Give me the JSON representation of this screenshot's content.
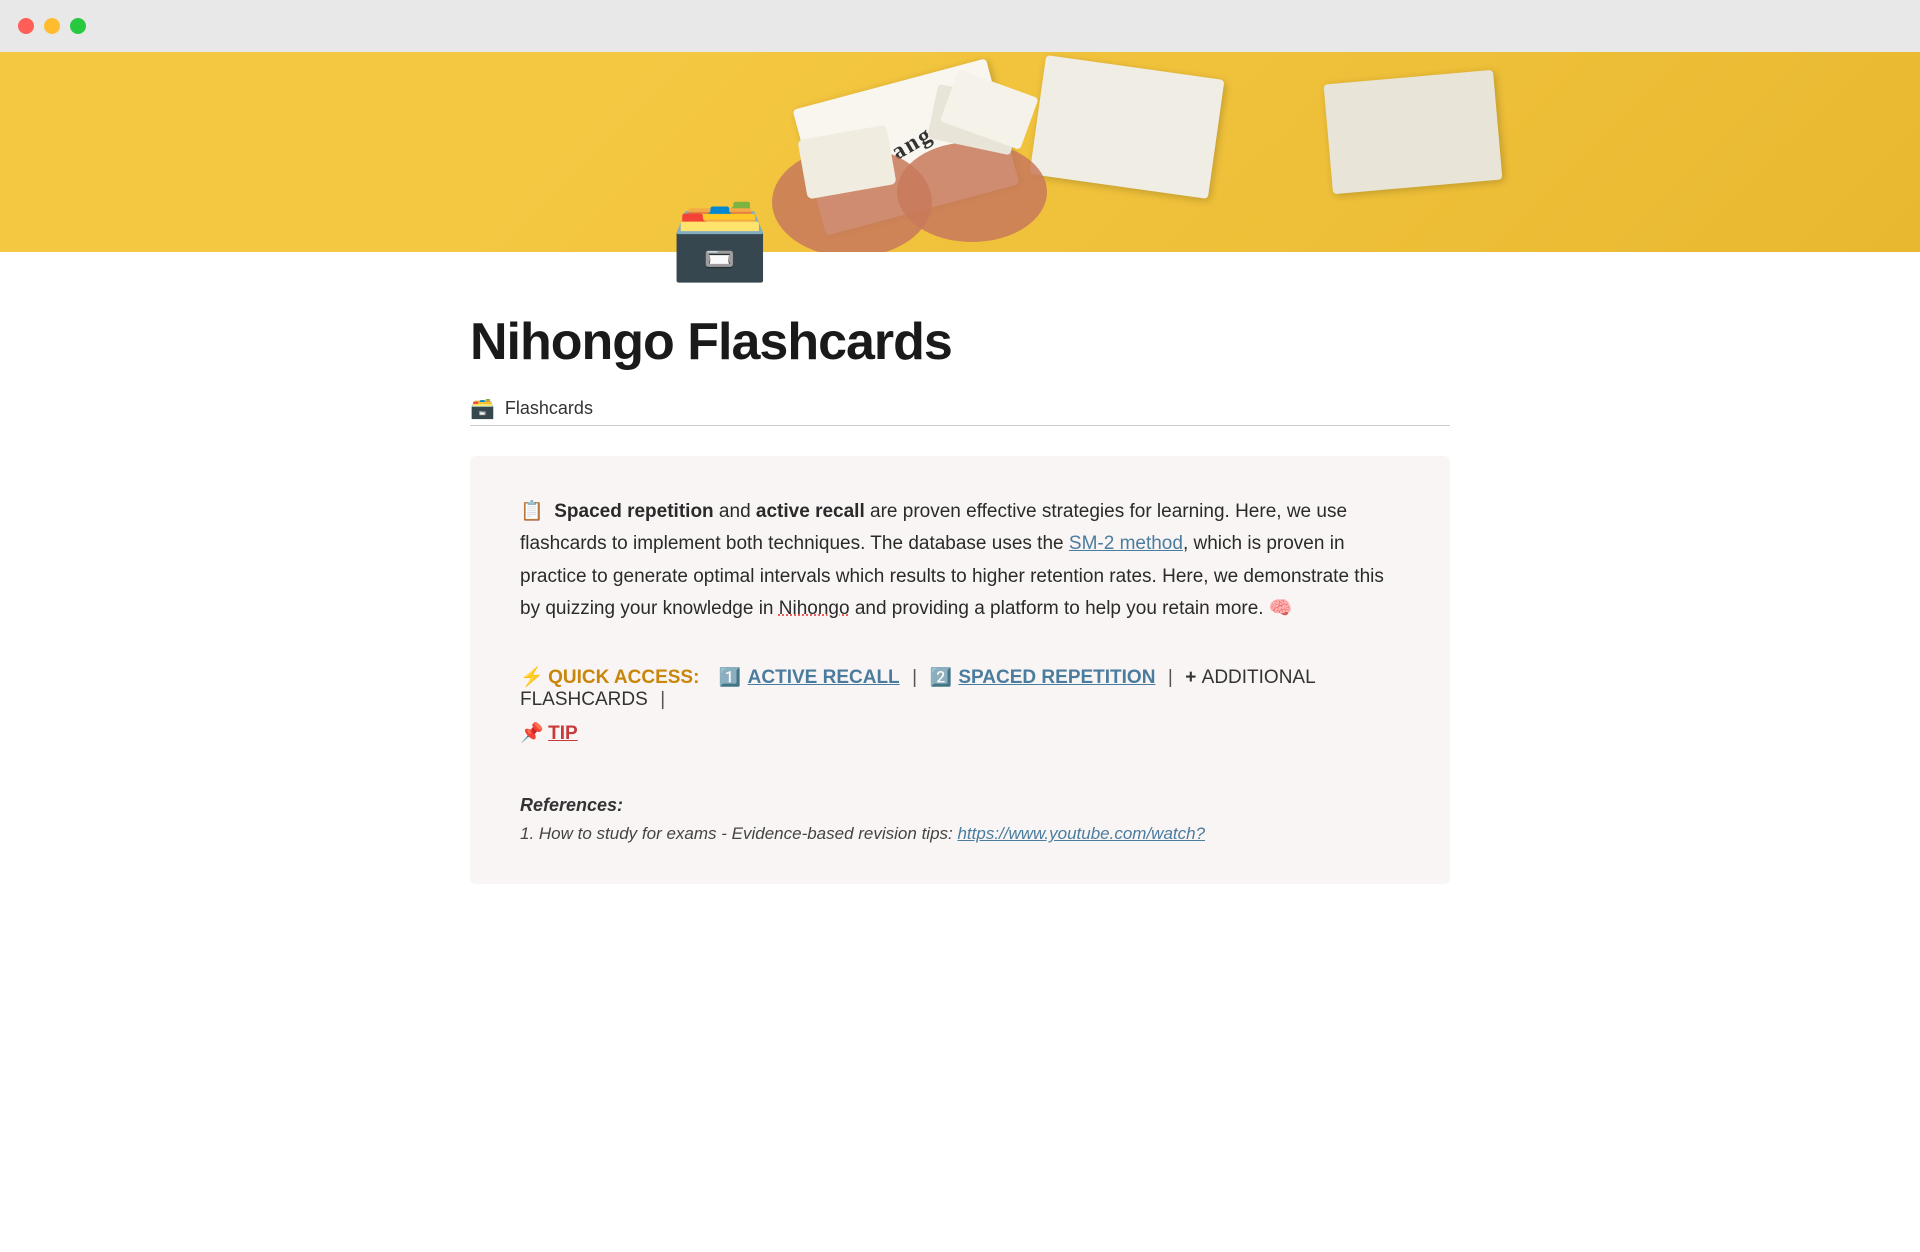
{
  "window": {
    "traffic_lights": [
      "close",
      "minimize",
      "maximize"
    ]
  },
  "hero": {
    "card1_text": "orange",
    "background_color": "#f5c842"
  },
  "page": {
    "icon_emoji": "🗃️",
    "title": "Nihongo Flashcards",
    "breadcrumb_icon": "🗃️",
    "breadcrumb_label": "Flashcards"
  },
  "infobox": {
    "paragraph": {
      "prefix_icon": "📋",
      "bold1": "Spaced repetition",
      "text1": " and ",
      "bold2": "active recall",
      "text2": " are proven effective strategies for learning. Here, we use flashcards to implement both techniques. The database uses the ",
      "link_text": "SM-2 method",
      "link_href": "#",
      "text3": ", which is proven in practice to generate optimal intervals which results to higher retention rates. Here, we demonstrate this by quizzing your knowledge in ",
      "underlined": "Nihongo",
      "text4": " and providing a platform to help you retain more. 🧠"
    },
    "quick_access": {
      "label_icon": "⚡",
      "label_text": "QUICK ACCESS:",
      "items": [
        {
          "number_icon": "1️⃣",
          "text": "ACTIVE RECALL",
          "href": "#active-recall",
          "color": "blue"
        },
        {
          "separator": "|"
        },
        {
          "number_icon": "2️⃣",
          "text": "SPACED REPETITION",
          "href": "#spaced-repetition",
          "color": "blue"
        },
        {
          "separator": "|"
        },
        {
          "icon": "+",
          "text": "ADDITIONAL FLASHCARDS",
          "href": "#additional",
          "color": "dark"
        },
        {
          "separator": "|"
        }
      ],
      "tip": {
        "icon": "📌",
        "text": "TIP",
        "href": "#tip"
      }
    }
  },
  "references": {
    "title": "References:",
    "items": [
      {
        "text": "1. How to study for exams - Evidence-based revision tips: ",
        "link_text": "https://www.youtube.com/watch?",
        "link_href": "https://www.youtube.com/watch?"
      }
    ]
  }
}
